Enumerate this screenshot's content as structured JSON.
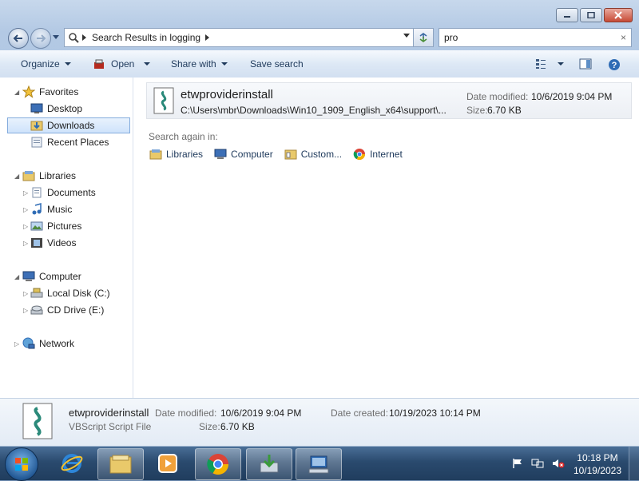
{
  "address": {
    "segments": [
      "Search Results in logging"
    ]
  },
  "search": {
    "value": "pro",
    "clear": "×"
  },
  "toolbar": {
    "organize": "Organize",
    "open": "Open",
    "share": "Share with",
    "save_search": "Save search"
  },
  "nav": {
    "favorites": "Favorites",
    "desktop": "Desktop",
    "downloads": "Downloads",
    "recent": "Recent Places",
    "libraries": "Libraries",
    "documents": "Documents",
    "music": "Music",
    "pictures": "Pictures",
    "videos": "Videos",
    "computer": "Computer",
    "local_disk": "Local Disk (C:)",
    "cd_drive": "CD Drive (E:)",
    "network": "Network"
  },
  "result": {
    "name": "etwproviderinstall",
    "path": "C:\\Users\\mbr\\Downloads\\Win10_1909_English_x64\\support\\...",
    "date_label": "Date modified:",
    "date": "10/6/2019 9:04 PM",
    "size_label": "Size:",
    "size": "6.70 KB"
  },
  "search_again": {
    "label": "Search again in:",
    "libraries": "Libraries",
    "computer": "Computer",
    "custom": "Custom...",
    "internet": "Internet"
  },
  "details": {
    "name": "etwproviderinstall",
    "type": "VBScript Script File",
    "date_modified_label": "Date modified:",
    "date_modified": "10/6/2019 9:04 PM",
    "size_label": "Size:",
    "size": "6.70 KB",
    "date_created_label": "Date created:",
    "date_created": "10/19/2023 10:14 PM"
  },
  "clock": {
    "time": "10:18 PM",
    "date": "10/19/2023"
  }
}
